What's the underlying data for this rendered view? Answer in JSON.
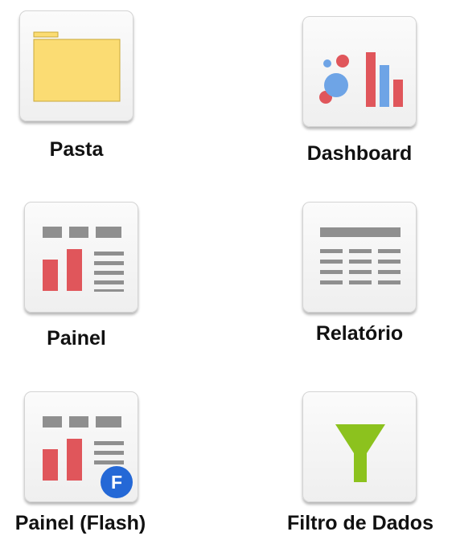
{
  "items": [
    {
      "label": "Pasta",
      "icon": "folder-icon"
    },
    {
      "label": "Dashboard",
      "icon": "dashboard-icon"
    },
    {
      "label": "Painel",
      "icon": "panel-icon"
    },
    {
      "label": "Relatório",
      "icon": "report-icon"
    },
    {
      "label": "Painel (Flash)",
      "icon": "panel-flash-icon",
      "badge": "F"
    },
    {
      "label": "Filtro de Dados",
      "icon": "data-filter-icon"
    }
  ],
  "colors": {
    "folder_yellow": "#fbdc73",
    "chart_red": "#e0565b",
    "chart_blue": "#6ea4e6",
    "bar_gray": "#8f8f8f",
    "filter_green": "#8cc21e",
    "badge_blue": "#2468d6"
  }
}
